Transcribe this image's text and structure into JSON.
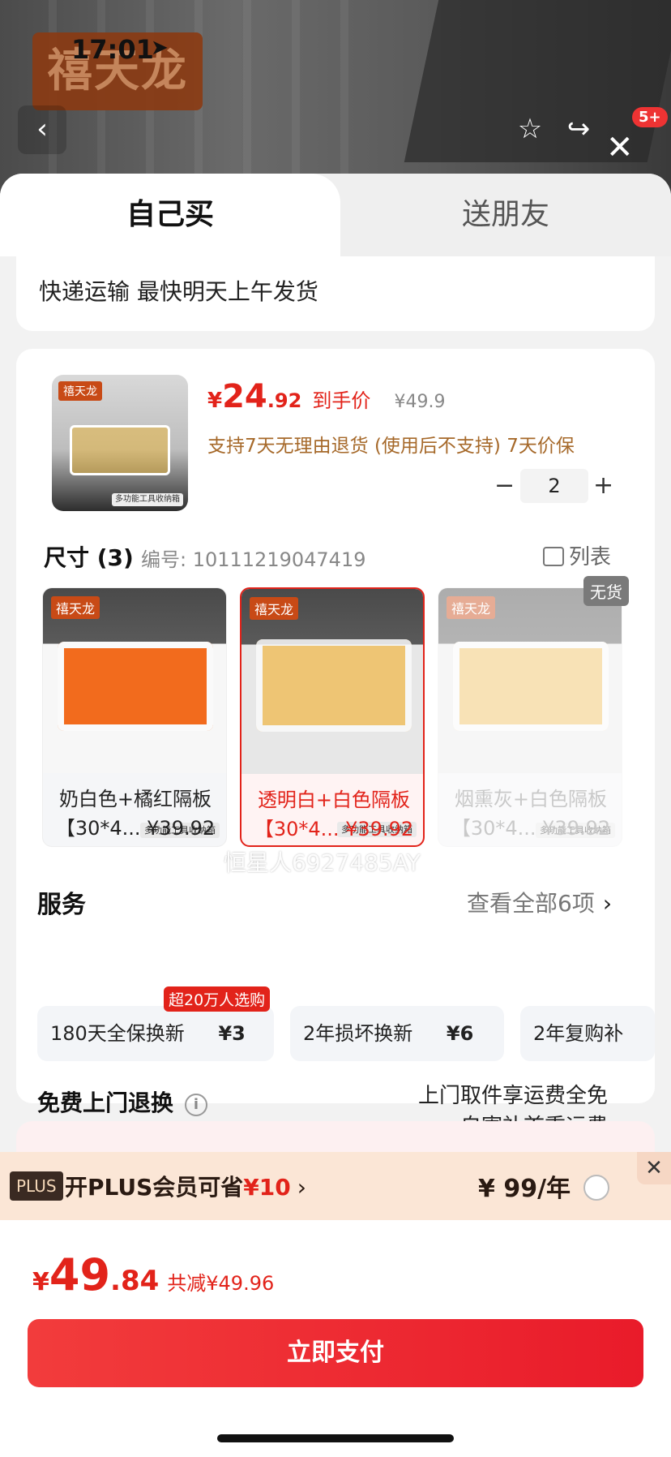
{
  "status": {
    "time": "17:01",
    "location_icon": "location-arrow-icon"
  },
  "hero": {
    "brand_text": "禧天龙",
    "cart_count": "5+"
  },
  "tabs": [
    {
      "label": "自己买"
    },
    {
      "label": "送朋友"
    }
  ],
  "shipping": {
    "text": "快递运输 最快明天上午发货"
  },
  "product": {
    "thumb_logo": "禧天龙",
    "thumb_tag": "多功能工具收纳箱",
    "price_symbol": "¥",
    "price_int": "24",
    "price_dec": ".92",
    "price_label": "到手价",
    "original_price": "¥49.9",
    "return_policy": "支持7天无理由退货 (使用后不支持)  7天价保",
    "quantity": "2"
  },
  "size": {
    "title": "尺寸 (3)",
    "code": "编号: 10111219047419",
    "list_label": "列表",
    "options": [
      {
        "logo": "禧天龙",
        "tag": "多功能工具收纳箱",
        "name": "奶白色+橘红隔板",
        "sub": "【30*4...  ¥39.92",
        "state": "normal"
      },
      {
        "logo": "禧天龙",
        "tag": "多功能工具收纳箱",
        "name": "透明白+白色隔板",
        "sub": "【30*4...  ¥39.92",
        "state": "selected"
      },
      {
        "logo": "禧天龙",
        "tag": "多功能工具收纳箱",
        "name": "烟熏灰+白色隔板",
        "sub": "【30*4...  ¥39.92",
        "state": "disabled"
      }
    ],
    "out_of_stock": "无货",
    "watermark": "恒星人6927485AY"
  },
  "services": {
    "title": "服务",
    "view_all": "查看全部6项",
    "hot_badge": "超20万人选购",
    "items": [
      {
        "name": "180天全保换新",
        "price": "¥3"
      },
      {
        "name": "2年损坏换新",
        "price": "¥6"
      },
      {
        "name": "2年复购补",
        "price": ""
      }
    ]
  },
  "door_service": {
    "title": "免费上门退换",
    "line1": "上门取件享运费全免",
    "line2": "自寄补首重运费"
  },
  "plus": {
    "badge": "PLUS",
    "text_prefix": "开PLUS会员可省",
    "save": "¥10",
    "price": "¥ 99/年"
  },
  "checkout": {
    "symbol": "¥",
    "int": "49",
    "dec": ".84",
    "saving": "共减¥49.96",
    "pay_label": "立即支付"
  },
  "colors": {
    "accent": "#e2231a",
    "plus_bg": "#fbe6d6",
    "policy": "#a6692a"
  }
}
